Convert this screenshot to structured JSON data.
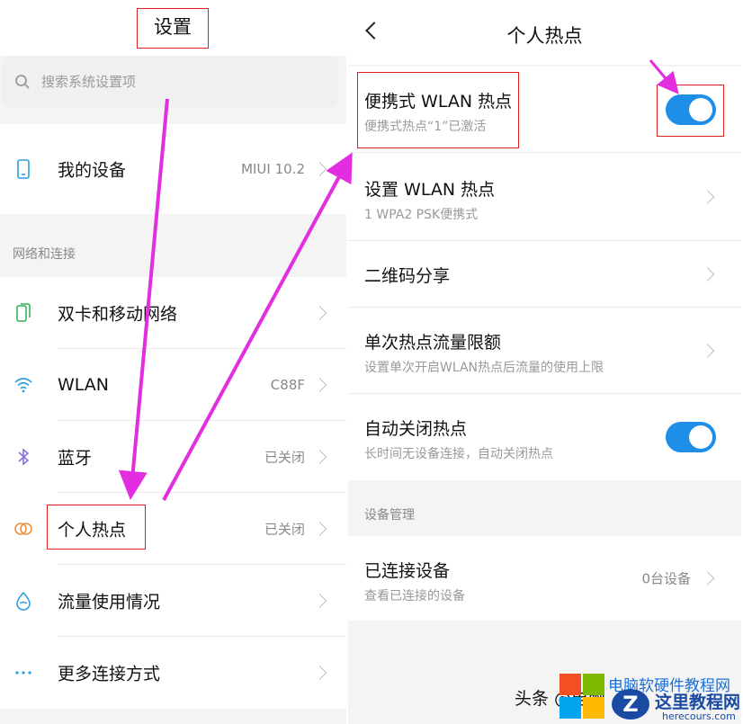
{
  "settings": {
    "title": "设置",
    "search_placeholder": "搜索系统设置项",
    "section_network": "网络和连接",
    "rows": [
      {
        "label": "我的设备",
        "value": "MIUI 10.2",
        "icon": "phone-icon"
      },
      {
        "label": "双卡和移动网络",
        "value": "",
        "icon": "sim-card-icon"
      },
      {
        "label": "WLAN",
        "value": "C88F",
        "icon": "wifi-icon"
      },
      {
        "label": "蓝牙",
        "value": "已关闭",
        "icon": "bluetooth-icon"
      },
      {
        "label": "个人热点",
        "value": "已关闭",
        "icon": "hotspot-icon"
      },
      {
        "label": "流量使用情况",
        "value": "",
        "icon": "data-usage-icon"
      },
      {
        "label": "更多连接方式",
        "value": "",
        "icon": "more-icon"
      }
    ]
  },
  "hotspot": {
    "title": "个人热点",
    "rows": [
      {
        "title": "便携式 WLAN 热点",
        "subtitle": "便携式热点“1”已激活",
        "toggle": true
      },
      {
        "title": "设置 WLAN 热点",
        "subtitle": "1 WPA2 PSK便携式"
      },
      {
        "title": "二维码分享",
        "subtitle": ""
      },
      {
        "title": "单次热点流量限额",
        "subtitle": "设置单次开启WLAN热点后流量的使用上限"
      },
      {
        "title": "自动关闭热点",
        "subtitle": "长时间无设备连接，自动关闭热点",
        "toggle": true
      }
    ],
    "section_devices": "设备管理",
    "connected": {
      "title": "已连接设备",
      "subtitle": "查看已连接的设备",
      "value": "0台设备"
    }
  },
  "watermark": {
    "prefix": "头条 @电脑",
    "site_cn": "这里教程网",
    "site_en": "herecours.com",
    "blue_text": "电脑软硬件教程网"
  },
  "colors": {
    "toggle_on": "#1e8ee8",
    "highlight_box": "#e0201d",
    "annotation_arrow": "#e22ee0"
  }
}
